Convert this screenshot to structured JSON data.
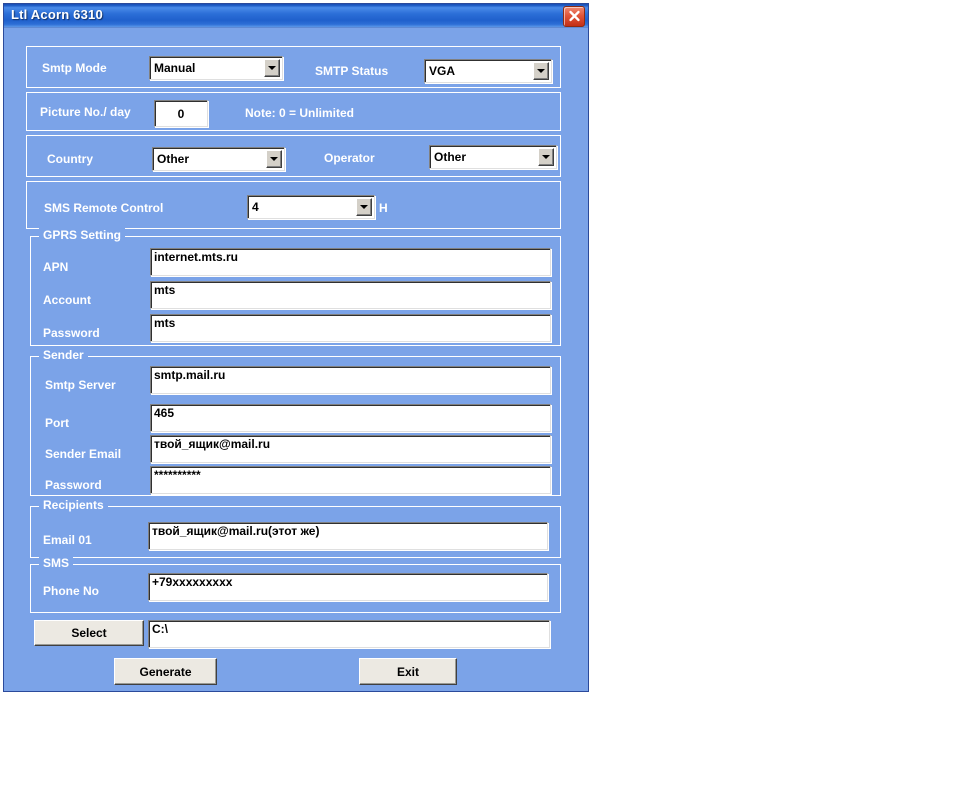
{
  "window": {
    "title": "Ltl Acorn 6310",
    "close_icon": "close-icon"
  },
  "smtp_row": {
    "mode_label": "Smtp Mode",
    "mode_value": "Manual",
    "status_label": "SMTP Status",
    "status_value": "VGA"
  },
  "picture_row": {
    "label": "Picture No./ day",
    "value": "0",
    "note": "Note: 0 = Unlimited"
  },
  "country_row": {
    "country_label": "Country",
    "country_value": "Other",
    "operator_label": "Operator",
    "operator_value": "Other"
  },
  "sms_remote_row": {
    "label": "SMS Remote Control",
    "value": "4",
    "unit": "H"
  },
  "gprs": {
    "title": "GPRS Setting",
    "apn_label": "APN",
    "apn_value": "internet.mts.ru",
    "account_label": "Account",
    "account_value": "mts",
    "password_label": "Password",
    "password_value": "mts"
  },
  "sender": {
    "title": "Sender",
    "server_label": "Smtp Server",
    "server_value": "smtp.mail.ru",
    "port_label": "Port",
    "port_value": "465",
    "email_label": "Sender Email",
    "email_value": "твой_ящик@mail.ru",
    "password_label": "Password",
    "password_value": "**********"
  },
  "recipients": {
    "title": "Recipients",
    "email01_label": "Email 01",
    "email01_value": "твой_ящик@mail.ru(этот же)"
  },
  "sms": {
    "title": "SMS",
    "phone_label": "Phone No",
    "phone_value": "+79xxxxxxxxx"
  },
  "path_row": {
    "select_label": "Select",
    "path_value": "C:\\"
  },
  "actions": {
    "generate_label": "Generate",
    "exit_label": "Exit"
  }
}
